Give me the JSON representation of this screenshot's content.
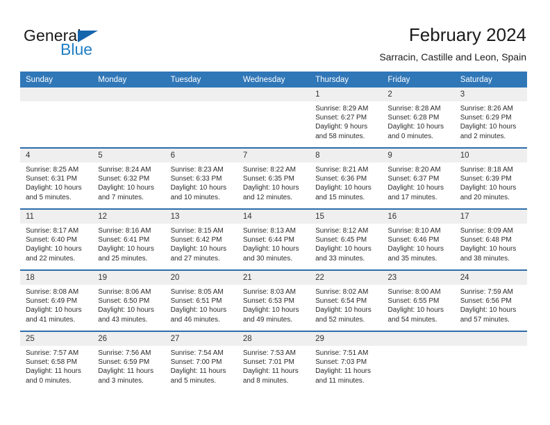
{
  "brand": {
    "word_one": "General",
    "word_two": "Blue",
    "accent_color": "#1f7ec4",
    "triangle_color": "#1565ad"
  },
  "header": {
    "title": "February 2024",
    "subtitle": "Sarracin, Castille and Leon, Spain"
  },
  "theme": {
    "header_blue": "#3077b8",
    "row_rule_blue": "#2b6ca9",
    "daynum_band": "#efefef"
  },
  "weekday_headers": [
    "Sunday",
    "Monday",
    "Tuesday",
    "Wednesday",
    "Thursday",
    "Friday",
    "Saturday"
  ],
  "weeks": [
    [
      {
        "day": "",
        "empty": true
      },
      {
        "day": "",
        "empty": true
      },
      {
        "day": "",
        "empty": true
      },
      {
        "day": "",
        "empty": true
      },
      {
        "day": "1",
        "sunrise": "Sunrise: 8:29 AM",
        "sunset": "Sunset: 6:27 PM",
        "daylight_1": "Daylight: 9 hours",
        "daylight_2": "and 58 minutes."
      },
      {
        "day": "2",
        "sunrise": "Sunrise: 8:28 AM",
        "sunset": "Sunset: 6:28 PM",
        "daylight_1": "Daylight: 10 hours",
        "daylight_2": "and 0 minutes."
      },
      {
        "day": "3",
        "sunrise": "Sunrise: 8:26 AM",
        "sunset": "Sunset: 6:29 PM",
        "daylight_1": "Daylight: 10 hours",
        "daylight_2": "and 2 minutes."
      }
    ],
    [
      {
        "day": "4",
        "sunrise": "Sunrise: 8:25 AM",
        "sunset": "Sunset: 6:31 PM",
        "daylight_1": "Daylight: 10 hours",
        "daylight_2": "and 5 minutes."
      },
      {
        "day": "5",
        "sunrise": "Sunrise: 8:24 AM",
        "sunset": "Sunset: 6:32 PM",
        "daylight_1": "Daylight: 10 hours",
        "daylight_2": "and 7 minutes."
      },
      {
        "day": "6",
        "sunrise": "Sunrise: 8:23 AM",
        "sunset": "Sunset: 6:33 PM",
        "daylight_1": "Daylight: 10 hours",
        "daylight_2": "and 10 minutes."
      },
      {
        "day": "7",
        "sunrise": "Sunrise: 8:22 AM",
        "sunset": "Sunset: 6:35 PM",
        "daylight_1": "Daylight: 10 hours",
        "daylight_2": "and 12 minutes."
      },
      {
        "day": "8",
        "sunrise": "Sunrise: 8:21 AM",
        "sunset": "Sunset: 6:36 PM",
        "daylight_1": "Daylight: 10 hours",
        "daylight_2": "and 15 minutes."
      },
      {
        "day": "9",
        "sunrise": "Sunrise: 8:20 AM",
        "sunset": "Sunset: 6:37 PM",
        "daylight_1": "Daylight: 10 hours",
        "daylight_2": "and 17 minutes."
      },
      {
        "day": "10",
        "sunrise": "Sunrise: 8:18 AM",
        "sunset": "Sunset: 6:39 PM",
        "daylight_1": "Daylight: 10 hours",
        "daylight_2": "and 20 minutes."
      }
    ],
    [
      {
        "day": "11",
        "sunrise": "Sunrise: 8:17 AM",
        "sunset": "Sunset: 6:40 PM",
        "daylight_1": "Daylight: 10 hours",
        "daylight_2": "and 22 minutes."
      },
      {
        "day": "12",
        "sunrise": "Sunrise: 8:16 AM",
        "sunset": "Sunset: 6:41 PM",
        "daylight_1": "Daylight: 10 hours",
        "daylight_2": "and 25 minutes."
      },
      {
        "day": "13",
        "sunrise": "Sunrise: 8:15 AM",
        "sunset": "Sunset: 6:42 PM",
        "daylight_1": "Daylight: 10 hours",
        "daylight_2": "and 27 minutes."
      },
      {
        "day": "14",
        "sunrise": "Sunrise: 8:13 AM",
        "sunset": "Sunset: 6:44 PM",
        "daylight_1": "Daylight: 10 hours",
        "daylight_2": "and 30 minutes."
      },
      {
        "day": "15",
        "sunrise": "Sunrise: 8:12 AM",
        "sunset": "Sunset: 6:45 PM",
        "daylight_1": "Daylight: 10 hours",
        "daylight_2": "and 33 minutes."
      },
      {
        "day": "16",
        "sunrise": "Sunrise: 8:10 AM",
        "sunset": "Sunset: 6:46 PM",
        "daylight_1": "Daylight: 10 hours",
        "daylight_2": "and 35 minutes."
      },
      {
        "day": "17",
        "sunrise": "Sunrise: 8:09 AM",
        "sunset": "Sunset: 6:48 PM",
        "daylight_1": "Daylight: 10 hours",
        "daylight_2": "and 38 minutes."
      }
    ],
    [
      {
        "day": "18",
        "sunrise": "Sunrise: 8:08 AM",
        "sunset": "Sunset: 6:49 PM",
        "daylight_1": "Daylight: 10 hours",
        "daylight_2": "and 41 minutes."
      },
      {
        "day": "19",
        "sunrise": "Sunrise: 8:06 AM",
        "sunset": "Sunset: 6:50 PM",
        "daylight_1": "Daylight: 10 hours",
        "daylight_2": "and 43 minutes."
      },
      {
        "day": "20",
        "sunrise": "Sunrise: 8:05 AM",
        "sunset": "Sunset: 6:51 PM",
        "daylight_1": "Daylight: 10 hours",
        "daylight_2": "and 46 minutes."
      },
      {
        "day": "21",
        "sunrise": "Sunrise: 8:03 AM",
        "sunset": "Sunset: 6:53 PM",
        "daylight_1": "Daylight: 10 hours",
        "daylight_2": "and 49 minutes."
      },
      {
        "day": "22",
        "sunrise": "Sunrise: 8:02 AM",
        "sunset": "Sunset: 6:54 PM",
        "daylight_1": "Daylight: 10 hours",
        "daylight_2": "and 52 minutes."
      },
      {
        "day": "23",
        "sunrise": "Sunrise: 8:00 AM",
        "sunset": "Sunset: 6:55 PM",
        "daylight_1": "Daylight: 10 hours",
        "daylight_2": "and 54 minutes."
      },
      {
        "day": "24",
        "sunrise": "Sunrise: 7:59 AM",
        "sunset": "Sunset: 6:56 PM",
        "daylight_1": "Daylight: 10 hours",
        "daylight_2": "and 57 minutes."
      }
    ],
    [
      {
        "day": "25",
        "sunrise": "Sunrise: 7:57 AM",
        "sunset": "Sunset: 6:58 PM",
        "daylight_1": "Daylight: 11 hours",
        "daylight_2": "and 0 minutes."
      },
      {
        "day": "26",
        "sunrise": "Sunrise: 7:56 AM",
        "sunset": "Sunset: 6:59 PM",
        "daylight_1": "Daylight: 11 hours",
        "daylight_2": "and 3 minutes."
      },
      {
        "day": "27",
        "sunrise": "Sunrise: 7:54 AM",
        "sunset": "Sunset: 7:00 PM",
        "daylight_1": "Daylight: 11 hours",
        "daylight_2": "and 5 minutes."
      },
      {
        "day": "28",
        "sunrise": "Sunrise: 7:53 AM",
        "sunset": "Sunset: 7:01 PM",
        "daylight_1": "Daylight: 11 hours",
        "daylight_2": "and 8 minutes."
      },
      {
        "day": "29",
        "sunrise": "Sunrise: 7:51 AM",
        "sunset": "Sunset: 7:03 PM",
        "daylight_1": "Daylight: 11 hours",
        "daylight_2": "and 11 minutes."
      },
      {
        "day": "",
        "empty": true
      },
      {
        "day": "",
        "empty": true
      }
    ]
  ]
}
